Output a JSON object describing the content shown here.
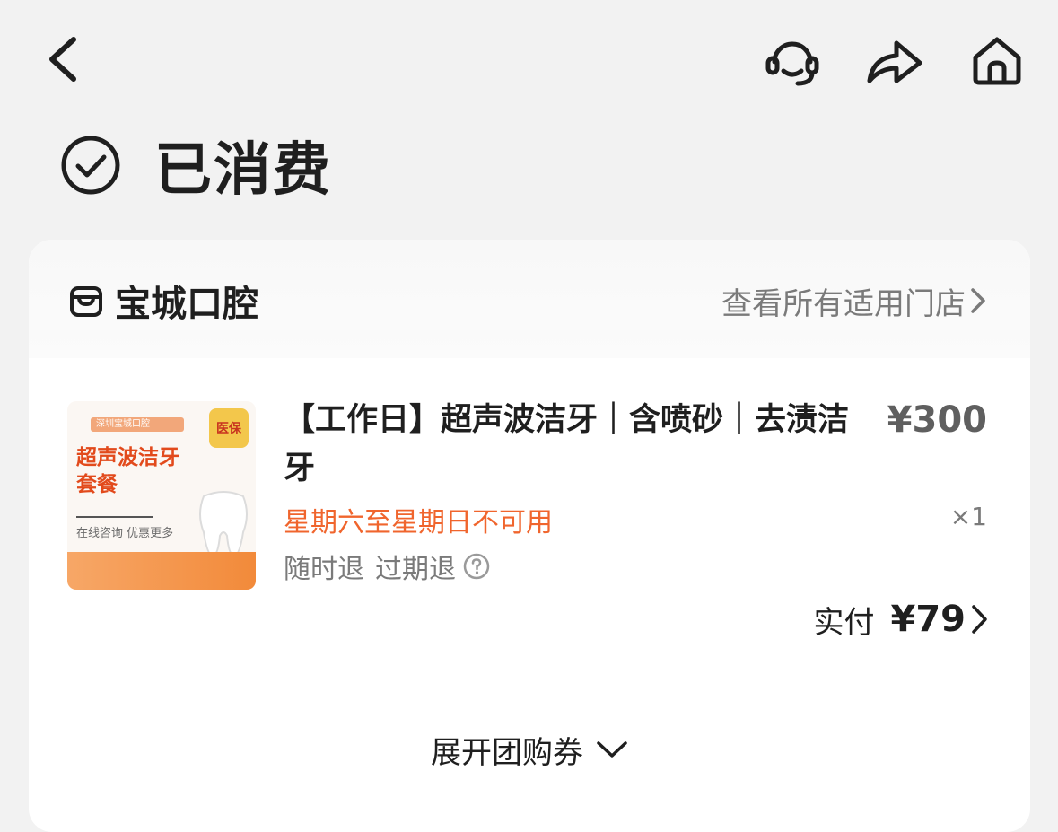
{
  "header": {
    "back_icon": "chevron-left-icon",
    "customer_service_icon": "headset-icon",
    "share_icon": "share-arrow-icon",
    "home_icon": "home-icon"
  },
  "status": {
    "icon": "check-circle-icon",
    "title": "已消费"
  },
  "shop": {
    "icon": "store-icon",
    "name": "宝城口腔",
    "stores_link": "查看所有适用门店"
  },
  "item": {
    "thumbnail": {
      "logo_text": "深圳宝城口腔",
      "badge": "医保",
      "title_line1": "超声波洁牙",
      "title_line2": "套餐",
      "subtitle": "在线咨询 优惠更多"
    },
    "title": "【工作日】超声波洁牙｜含喷砂｜去渍洁牙",
    "unit_price": "¥300",
    "quantity": "×1",
    "restriction": "星期六至星期日不可用",
    "refund_anytime": "随时退",
    "refund_expired": "过期退",
    "paid_label": "实付",
    "paid_amount": "¥79"
  },
  "expand": {
    "label": "展开团购券"
  },
  "colors": {
    "background": "#f2f2f2",
    "accent_orange": "#f0652d",
    "text_primary": "#1f1f1f",
    "text_secondary": "#7a7a7a"
  }
}
